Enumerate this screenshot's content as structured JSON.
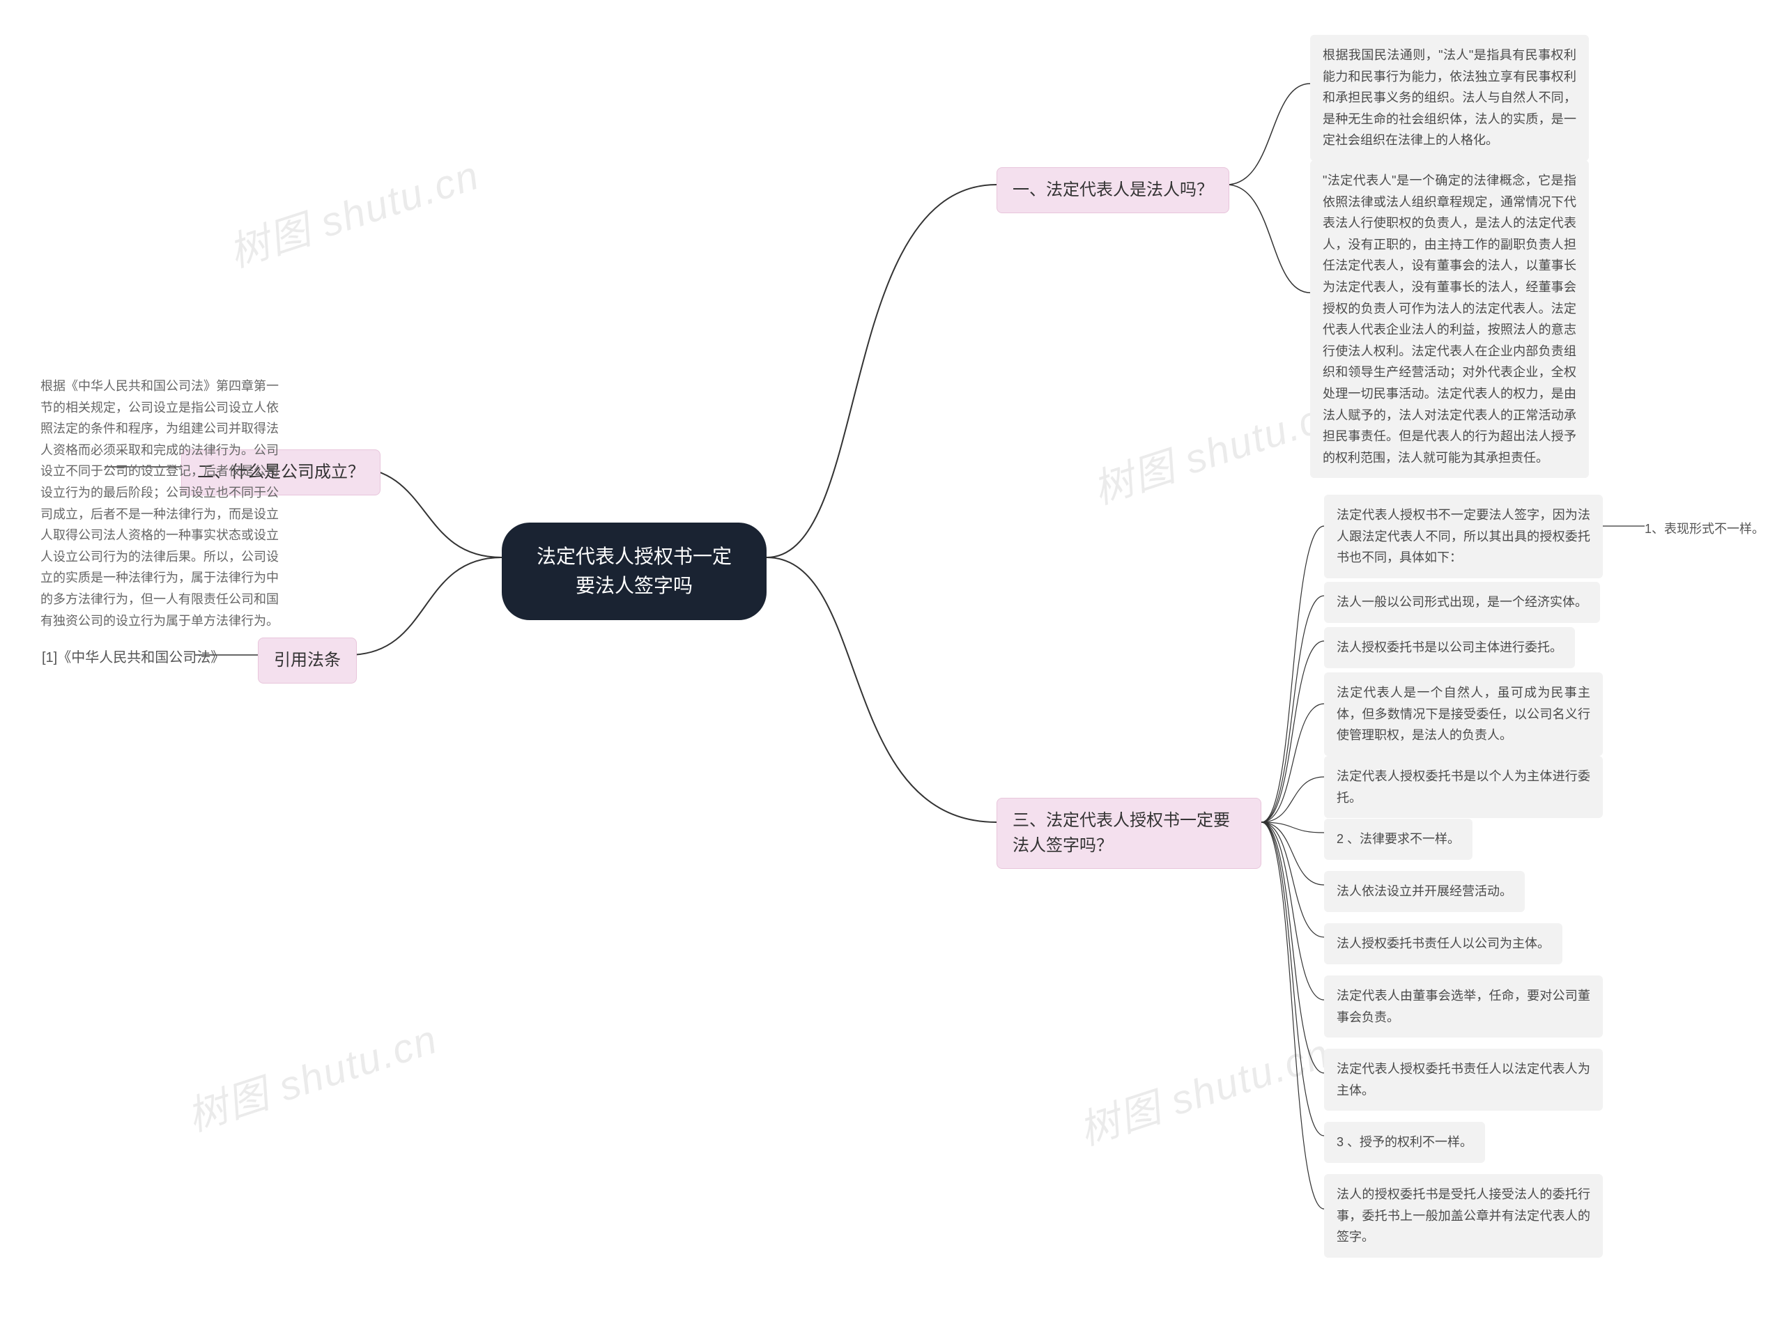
{
  "root": {
    "title": "法定代表人授权书一定要法人签字吗"
  },
  "branches": {
    "b1": {
      "label": "一、法定代表人是法人吗？"
    },
    "b2": {
      "label": "二、什么是公司成立？"
    },
    "b3": {
      "label": "三、法定代表人授权书一定要法人签字吗？"
    },
    "b4": {
      "label": "引用法条"
    }
  },
  "leaves": {
    "b1_1": "根据我国民法通则，\"法人\"是指具有民事权利能力和民事行为能力，依法独立享有民事权利和承担民事义务的组织。法人与自然人不同，是种无生命的社会组织体，法人的实质，是一定社会组织在法律上的人格化。",
    "b1_2": "\"法定代表人\"是一个确定的法律概念，它是指依照法律或法人组织章程规定，通常情况下代表法人行使职权的负责人，是法人的法定代表人，没有正职的，由主持工作的副职负责人担任法定代表人，设有董事会的法人，以董事长为法定代表人，没有董事长的法人，经董事会授权的负责人可作为法人的法定代表人。法定代表人代表企业法人的利益，按照法人的意志行使法人权利。法定代表人在企业内部负责组织和领导生产经营活动；对外代表企业，全权处理一切民事活动。法定代表人的权力，是由法人赋予的，法人对法定代表人的正常活动承担民事责任。但是代表人的行为超出法人授予的权利范围，法人就可能为其承担责任。",
    "b2_1": "根据《中华人民共和国公司法》第四章第一节的相关规定，公司设立是指公司设立人依照法定的条件和程序，为组建公司并取得法人资格而必须采取和完成的法律行为。公司设立不同于公司的设立登记，后者仅是公司设立行为的最后阶段；公司设立也不同于公司成立，后者不是一种法律行为，而是设立人取得公司法人资格的一种事实状态或设立人设立公司行为的法律后果。所以，公司设立的实质是一种法律行为，属于法律行为中的多方法律行为，但一人有限责任公司和国有独资公司的设立行为属于单方法律行为。",
    "b3_1": "法定代表人授权书不一定要法人签字，因为法人跟法定代表人不同，所以其出具的授权委托书也不同，具体如下：",
    "b3_1_sub": "1、表现形式不一样。",
    "b3_2": "法人一般以公司形式出现，是一个经济实体。",
    "b3_3": "法人授权委托书是以公司主体进行委托。",
    "b3_4": "法定代表人是一个自然人，虽可成为民事主体，但多数情况下是接受委任，以公司名义行使管理职权，是法人的负责人。",
    "b3_5": "法定代表人授权委托书是以个人为主体进行委托。",
    "b3_6": "2 、法律要求不一样。",
    "b3_7": "法人依法设立并开展经营活动。",
    "b3_8": "法人授权委托书责任人以公司为主体。",
    "b3_9": "法定代表人由董事会选举，任命，要对公司董事会负责。",
    "b3_10": "法定代表人授权委托书责任人以法定代表人为主体。",
    "b3_11": "3 、授予的权利不一样。",
    "b3_12": "法人的授权委托书是受托人接受法人的委托行事，委托书上一般加盖公章并有法定代表人的签字。",
    "b4_1": "[1]《中华人民共和国公司法》"
  },
  "watermark": "树图 shutu.cn"
}
